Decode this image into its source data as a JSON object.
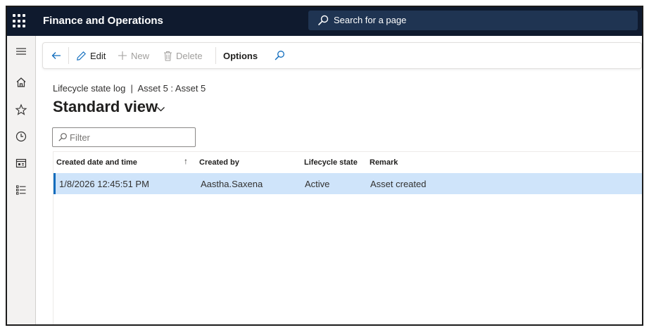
{
  "app": {
    "title": "Finance and Operations"
  },
  "search": {
    "placeholder": "Search for a page"
  },
  "toolbar": {
    "edit_label": "Edit",
    "new_label": "New",
    "delete_label": "Delete",
    "options_label": "Options"
  },
  "page": {
    "breadcrumb": "Lifecycle state log  |  Asset 5 : Asset 5",
    "view_title": "Standard view"
  },
  "filter": {
    "placeholder": "Filter"
  },
  "grid": {
    "columns": [
      "Created date and time",
      "Created by",
      "Lifecycle state",
      "Remark"
    ],
    "rows": [
      [
        "1/8/2026 12:45:51 PM",
        "Aastha.Saxena",
        "Active",
        "Asset created"
      ]
    ]
  },
  "colors": {
    "topbar": "#0f1a2e",
    "search_bg": "#1f3452",
    "selected_row": "#cfe4fa",
    "accent": "#0f6cbd"
  }
}
